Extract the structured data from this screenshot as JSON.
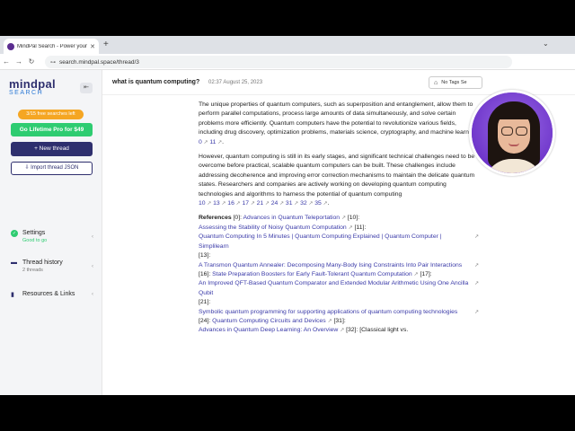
{
  "browser": {
    "tab_title": "MindPal Search - Power your r",
    "tab_close": "✕",
    "new_tab": "+",
    "url": "search.mindpal.space/thread/3"
  },
  "sidebar": {
    "logo_top": "mindpal",
    "logo_bottom": "SEARCH",
    "collapse": "⇤",
    "searches_left": "3/15 free searches left",
    "pro_button": "Go Lifetime Pro for $49",
    "new_thread": "+ New thread",
    "import": "⇩ Import thread JSON",
    "settings": {
      "label": "Settings",
      "sub": "Good to go"
    },
    "history": {
      "label": "Thread history",
      "sub": "2 threads"
    },
    "resources": {
      "label": "Resources & Links"
    }
  },
  "header": {
    "question": "what is quantum computing?",
    "date": "02:37 August 25, 2023",
    "tags_button": "No Tags Se"
  },
  "content": {
    "p1": "The unique properties of quantum computers, such as superposition and entanglement, allow them to perform parallel computations, process large amounts of data simultaneously, and solve certain problems more efficiently. Quantum computers have the potential to revolutionize various fields, including drug discovery, optimization problems, materials science, cryptography, and machine learning",
    "p1_cites": [
      "0",
      "11"
    ],
    "p2": "However, quantum computing is still in its early stages, and significant technical challenges need to be overcome before practical, scalable quantum computers can be built. These challenges include addressing decoherence and improving error correction mechanisms to maintain the delicate quantum states. Researchers and companies are actively working on developing quantum computing technologies and algorithms to harness the potential of quantum computing",
    "p2_cites": [
      "10",
      "13",
      "16",
      "17",
      "21",
      "24",
      "31",
      "32",
      "35"
    ],
    "references_label": "References",
    "refs": {
      "r0_idx": "[0]:",
      "r0": "Advances in Quantum Teleportation",
      "r10_idx": "[10]:",
      "r10": "Assessing the Stability of Noisy Quantum Computation",
      "r11_idx": "[11]:",
      "r11": "Quantum Computing In 5 Minutes | Quantum Computing Explained | Quantum Computer | Simplilearn",
      "r13_idx": "[13]:",
      "r13": "A Transmon Quantum Annealer: Decomposing Many-Body Ising Constraints Into Pair Interactions",
      "r16_idx": "[16]:",
      "r16": "State Preparation Boosters for Early Fault-Tolerant Quantum Computation",
      "r17_idx": "[17]:",
      "r17": "An Improved QFT-Based Quantum Comparator and Extended Modular Arithmetic Using One Ancilla Qubit",
      "r21_idx": "[21]:",
      "r21": "Symbolic quantum programming for supporting applications of quantum computing technologies",
      "r24_idx": "[24]:",
      "r24": "Quantum Computing Circuits and Devices",
      "r31_idx": "[31]:",
      "r31": "Advances in Quantum Deep Learning: An Overview",
      "r32_idx": "[32]:",
      "r32": "[Classical light vs."
    }
  }
}
